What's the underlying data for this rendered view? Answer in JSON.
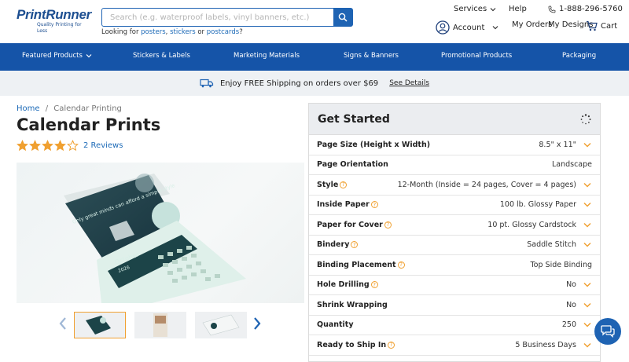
{
  "header": {
    "logo_text": "PrintRunner",
    "logo_tagline": "Quality Printing for Less",
    "search_placeholder": "Search (e.g. waterproof labels, vinyl banners, etc.)",
    "looking_prefix": "Looking for",
    "looking_links": [
      "posters",
      "stickers",
      "postcards"
    ],
    "looking_sep_1": ",",
    "looking_sep_2": "or",
    "looking_suffix": "?",
    "services": "Services",
    "help": "Help",
    "phone": "1-888-296-5760",
    "account": "Account",
    "my_orders": "My Orders",
    "my_designs": "My Designs",
    "cart": "Cart"
  },
  "nav": {
    "items": [
      "Featured Products",
      "Stickers & Labels",
      "Marketing Materials",
      "Signs & Banners",
      "Promotional Products",
      "Packaging"
    ]
  },
  "promo": {
    "text": "Enjoy FREE Shipping on orders over $69",
    "link": "See Details"
  },
  "product": {
    "breadcrumb_home": "Home",
    "breadcrumb_sep": "/",
    "breadcrumb_current": "Calendar Printing",
    "title": "Calendar Prints",
    "rating": 4,
    "rating_max": 5,
    "reviews": "2 Reviews",
    "image_headline": "Only great minds can afford a simple style",
    "image_month": "October",
    "image_year": "2026"
  },
  "config": {
    "heading": "Get Started",
    "rows": [
      {
        "label": "Page Size (Height x Width)",
        "value": "8.5\" x 11\"",
        "help": false,
        "dropdown": true
      },
      {
        "label": "Page Orientation",
        "value": "Landscape",
        "help": false,
        "dropdown": false
      },
      {
        "label": "Style",
        "value": "12-Month (Inside = 24 pages, Cover = 4 pages)",
        "help": true,
        "dropdown": true
      },
      {
        "label": "Inside Paper",
        "value": "100 lb. Glossy Paper",
        "help": true,
        "dropdown": true
      },
      {
        "label": "Paper for Cover",
        "value": "10 pt. Glossy Cardstock",
        "help": true,
        "dropdown": true
      },
      {
        "label": "Bindery",
        "value": "Saddle Stitch",
        "help": true,
        "dropdown": true
      },
      {
        "label": "Binding Placement",
        "value": "Top Side Binding",
        "help": true,
        "dropdown": false
      },
      {
        "label": "Hole Drilling",
        "value": "No",
        "help": true,
        "dropdown": true
      },
      {
        "label": "Shrink Wrapping",
        "value": "No",
        "help": false,
        "dropdown": true
      },
      {
        "label": "Quantity",
        "value": "250",
        "help": false,
        "dropdown": true
      },
      {
        "label": "Ready to Ship In",
        "value": "5 Business Days",
        "help": true,
        "dropdown": true
      }
    ]
  },
  "colors": {
    "brand": "#1554a8",
    "accent": "#f0a030",
    "link": "#1e6bb8"
  }
}
